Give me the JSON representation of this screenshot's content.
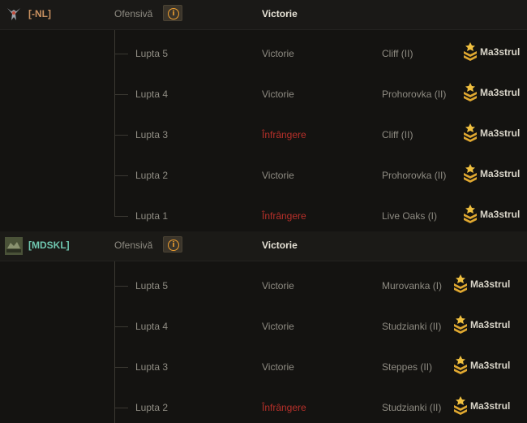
{
  "colors": {
    "win": "#8e8b82",
    "loss": "#b8302a",
    "clan1_tag": "#c89060",
    "clan2_tag": "#6fc7b0",
    "accent": "#f0a030"
  },
  "clans": [
    {
      "tag": "[-NL]",
      "emblem_icon": "emblem-nl-icon",
      "mode": "Ofensivă",
      "result": "Victorie",
      "battles": [
        {
          "label": "Lupta 5",
          "result": "Victorie",
          "outcome": "win",
          "map": "Cliff (II)",
          "player": "Ma3strul"
        },
        {
          "label": "Lupta 4",
          "result": "Victorie",
          "outcome": "win",
          "map": "Prohorovka (II)",
          "player": "Ma3strul"
        },
        {
          "label": "Lupta 3",
          "result": "Înfrângere",
          "outcome": "loss",
          "map": "Cliff (II)",
          "player": "Ma3strul"
        },
        {
          "label": "Lupta 2",
          "result": "Victorie",
          "outcome": "win",
          "map": "Prohorovka (II)",
          "player": "Ma3strul"
        },
        {
          "label": "Lupta 1",
          "result": "Înfrângere",
          "outcome": "loss",
          "map": "Live Oaks (I)",
          "player": "Ma3strul"
        }
      ]
    },
    {
      "tag": "[MDSKL]",
      "emblem_icon": "emblem-mdskl-icon",
      "mode": "Ofensivă",
      "result": "Victorie",
      "battles": [
        {
          "label": "Lupta 5",
          "result": "Victorie",
          "outcome": "win",
          "map": "Murovanka (I)",
          "player": "Ma3strul"
        },
        {
          "label": "Lupta 4",
          "result": "Victorie",
          "outcome": "win",
          "map": "Studzianki (II)",
          "player": "Ma3strul"
        },
        {
          "label": "Lupta 3",
          "result": "Victorie",
          "outcome": "win",
          "map": "Steppes (II)",
          "player": "Ma3strul"
        },
        {
          "label": "Lupta 2",
          "result": "Înfrângere",
          "outcome": "loss",
          "map": "Studzianki (II)",
          "player": "Ma3strul"
        }
      ]
    }
  ]
}
